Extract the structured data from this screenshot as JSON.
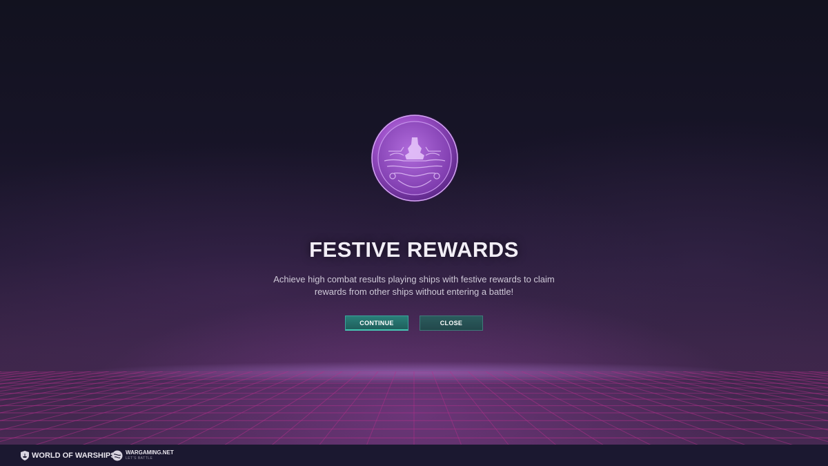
{
  "screen": {
    "title": "FESTIVE REWARDS",
    "description_lines": [
      "Achieve high combat results playing ships with festive rewards to claim",
      "rewards from other ships without entering a battle!"
    ]
  },
  "buttons": {
    "continue_label": "CONTINUE",
    "close_label": "CLOSE"
  },
  "footer": {
    "game_logo_text": "WORLD OF WARSHIPS",
    "publisher_logo_text": "WARGAMING.NET",
    "publisher_tagline": "LET'S BATTLE"
  },
  "icons": {
    "coin": "festive-reward-coin-icon",
    "game_logo": "warships-shield-icon",
    "publisher_logo": "wargaming-globe-icon"
  },
  "colors": {
    "coin": "#9b4fc7",
    "button_primary": "#2a7f79",
    "button_secondary": "#2b5b5d",
    "grid": "#b0308a"
  }
}
